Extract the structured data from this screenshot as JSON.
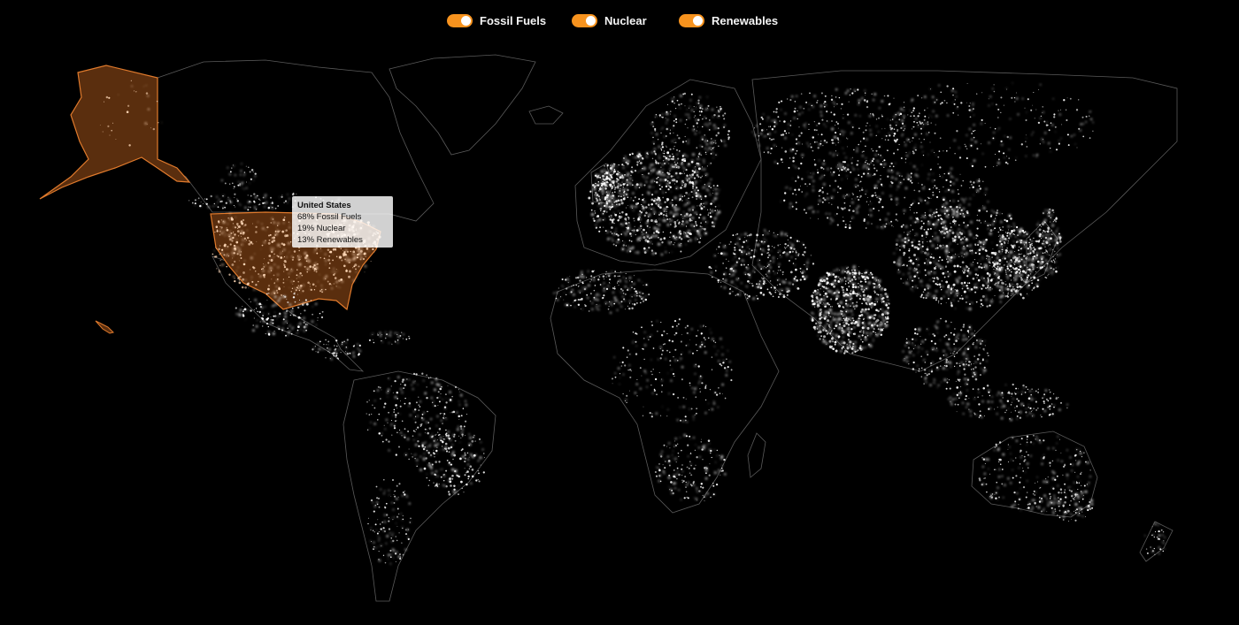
{
  "legend": {
    "toggles": [
      {
        "label": "Fossil Fuels",
        "on": true
      },
      {
        "label": "Nuclear",
        "on": true
      },
      {
        "label": "Renewables",
        "on": true
      }
    ]
  },
  "tooltip": {
    "country": "United States",
    "lines": [
      "68% Fossil Fuels",
      "19% Nuclear",
      "13% Renewables"
    ]
  },
  "map": {
    "highlighted_country": "United States",
    "style": "night lights"
  },
  "colors": {
    "background": "#000000",
    "accent": "#f7931e",
    "highlight_fill": "#5a2e0e",
    "highlight_stroke": "#e07a2c",
    "lights": "#ffffff",
    "borders": "#5a5a5a"
  }
}
